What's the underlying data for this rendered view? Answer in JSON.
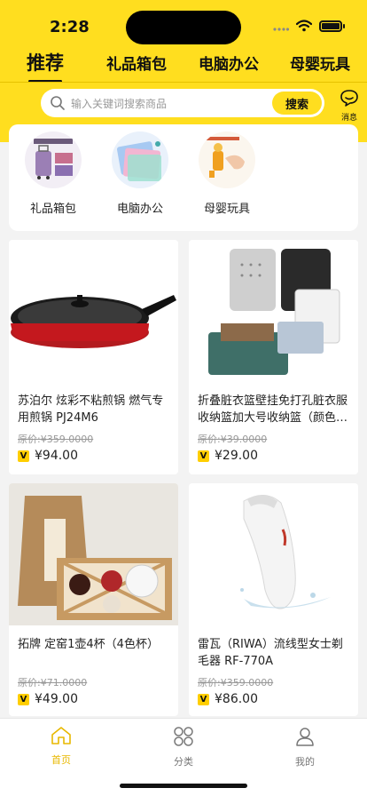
{
  "status_bar": {
    "time": "2:28"
  },
  "tabs": [
    {
      "label": "推荐",
      "active": true
    },
    {
      "label": "礼品箱包",
      "active": false
    },
    {
      "label": "电脑办公",
      "active": false
    },
    {
      "label": "母婴玩具",
      "active": false
    }
  ],
  "search": {
    "placeholder": "输入关键词搜索商品",
    "button": "搜索"
  },
  "message": {
    "label": "消息",
    "icon": "chat-smile-icon"
  },
  "categories": [
    {
      "name": "礼品箱包",
      "icon": "luggage-image"
    },
    {
      "name": "电脑办公",
      "icon": "folders-image"
    },
    {
      "name": "母婴玩具",
      "icon": "toy-image"
    }
  ],
  "products": [
    {
      "title": "苏泊尔 炫彩不粘煎锅 燃气专用煎锅 PJ24M6",
      "original_price": "原价:¥359.0000",
      "price": "¥94.00",
      "badge": "V"
    },
    {
      "title": "折叠脏衣篮壁挂免打孔脏衣服收纳篮加大号收纳篮（颜色…",
      "original_price": "原价:¥39.0000",
      "price": "¥29.00",
      "badge": "V"
    },
    {
      "title": "拓牌 定窑1壶4杯（4色杯）",
      "original_price": "原价:¥71.0000",
      "price": "¥49.00",
      "badge": "V"
    },
    {
      "title": "雷瓦（RIWA）流线型女士剃毛器 RF-770A",
      "original_price": "原价:¥359.0000",
      "price": "¥86.00",
      "badge": "V"
    }
  ],
  "tabbar": [
    {
      "label": "首页",
      "icon": "home-icon",
      "active": true
    },
    {
      "label": "分类",
      "icon": "grid-circles-icon",
      "active": false
    },
    {
      "label": "我的",
      "icon": "user-icon",
      "active": false
    }
  ],
  "colors": {
    "accent": "#ffde1f",
    "active_tab": "#e8b800",
    "text": "#222222",
    "muted": "#999999"
  }
}
